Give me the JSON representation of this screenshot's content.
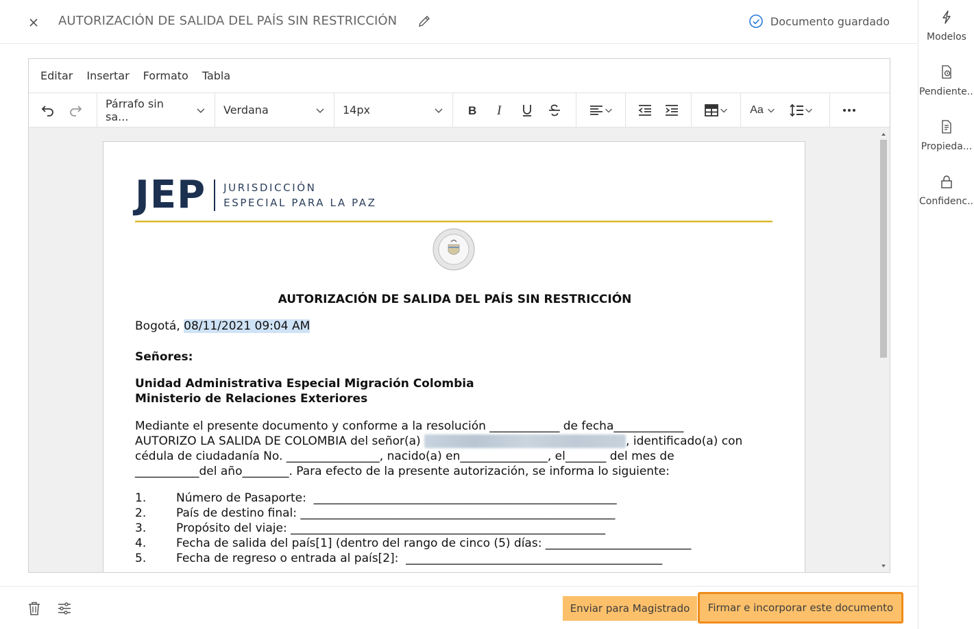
{
  "header": {
    "title": "AUTORIZACIÓN DE SALIDA DEL PAÍS SIN RESTRICCIÓN",
    "status": "Documento guardado"
  },
  "menubar": [
    "Editar",
    "Insertar",
    "Formato",
    "Tabla"
  ],
  "toolbar": {
    "block_format": "Párrafo sin sa...",
    "font_family": "Verdana",
    "font_size": "14px",
    "case_label": "Aa"
  },
  "document": {
    "logo_mark": "JEP",
    "logo_line1": "JURISDICCIÓN",
    "logo_line2": "ESPECIAL PARA LA PAZ",
    "title": "AUTORIZACIÓN DE SALIDA DEL PAÍS SIN RESTRICCIÓN",
    "city_prefix": "Bogotá, ",
    "date": "08/11/2021 09:04 AM",
    "salutation": "Señores:",
    "recipient1": "Unidad Administrativa Especial Migración Colombia",
    "recipient2": "Ministerio de Relaciones Exteriores",
    "para_line1": "Mediante el presente documento y conforme a la resolución ____________ de fecha____________",
    "para_line2_a": "AUTORIZO LA SALIDA DE COLOMBIA del señor(a) ",
    "para_line2_b": ", identificado(a) con",
    "para_line3": "cédula de ciudadanía No. ________________, nacido(a) en_______________, el_______ del mes de",
    "para_line4": "___________del año________. Para efecto de la presente autorización, se informa lo siguiente:",
    "list": [
      {
        "num": "1.",
        "text": "Número de Pasaporte:  ____________________________________________________"
      },
      {
        "num": "2.",
        "text": "País de destino final: ______________________________________________________"
      },
      {
        "num": "3.",
        "text": "Propósito del viaje: ______________________________________________________"
      },
      {
        "num": "4.",
        "text": "Fecha de salida del país[1] (dentro del rango de cinco (5) días: _________________________"
      },
      {
        "num": "5.",
        "text": "Fecha de regreso o entrada al país[2]:  ____________________________________________"
      }
    ]
  },
  "footer": {
    "send_label": "Enviar para Magistrado",
    "sign_label": "Firmar e incorporar este documento"
  },
  "rail": {
    "models": "Modelos",
    "pending": "Pendiente...",
    "properties": "Propieda...",
    "confidential": "Confidenc..."
  },
  "colors": {
    "accent_button": "#fcc06a",
    "highlight_border": "#ef8b1a",
    "saved_check": "#2a7ad6",
    "brand_navy": "#1c3050",
    "gold_rule": "#d8b82a"
  }
}
